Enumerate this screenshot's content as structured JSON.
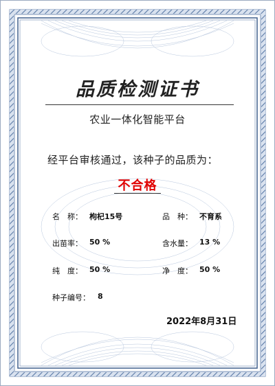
{
  "certificate": {
    "title": "品质检测证书",
    "issuer": "农业一体化智能平台",
    "statement": "经平台审核通过，该种子的品质为：",
    "result": "不合格",
    "result_color": "#e00000",
    "border_color": "#5b7aa6",
    "fields": {
      "name": {
        "label": "名　称：",
        "value": "枸杞15号"
      },
      "variety": {
        "label": "品　种：",
        "value": "不育系"
      },
      "germination": {
        "label": "出苗率：",
        "value": "50 %"
      },
      "moisture": {
        "label": "含水量：",
        "value": "13 %"
      },
      "purity": {
        "label": "纯　度：",
        "value": "50 %"
      },
      "clarity": {
        "label": "净　度：",
        "value": "50 %"
      },
      "seed_no": {
        "label": "种子编号：",
        "value": "8"
      }
    },
    "date": "2022年8月31日"
  }
}
